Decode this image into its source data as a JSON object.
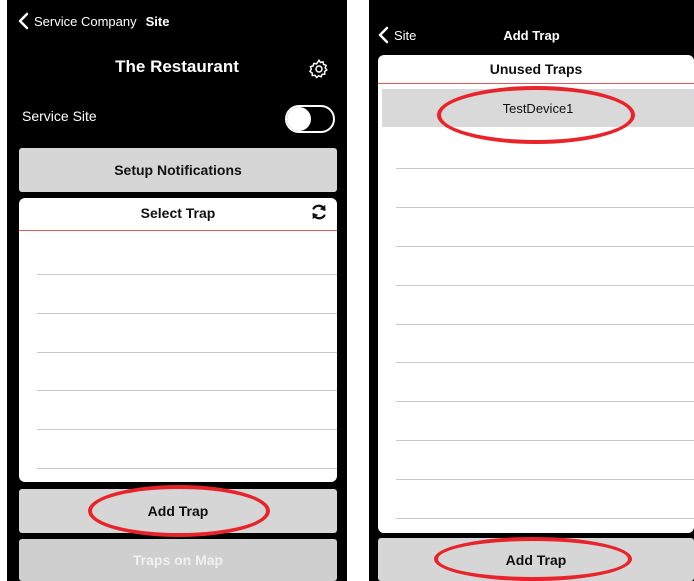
{
  "left_screen": {
    "nav": {
      "back_label": "Service Company",
      "current_label": "Site"
    },
    "title": "The Restaurant",
    "service_site": {
      "label": "Service Site",
      "enabled": false
    },
    "setup_notifications_label": "Setup Notifications",
    "select_trap": {
      "header": "Select Trap",
      "rows": 6
    },
    "add_trap_label": "Add Trap",
    "traps_on_map_label": "Traps on Map"
  },
  "right_screen": {
    "nav": {
      "back_label": "Site",
      "title": "Add Trap"
    },
    "unused_traps": {
      "header": "Unused Traps",
      "items": [
        "TestDevice1"
      ]
    },
    "add_trap_label": "Add Trap"
  },
  "colors": {
    "highlight_ellipse": "#e8232a",
    "header_rule": "#e85a5a",
    "button_gray": "#d6d6d6"
  }
}
